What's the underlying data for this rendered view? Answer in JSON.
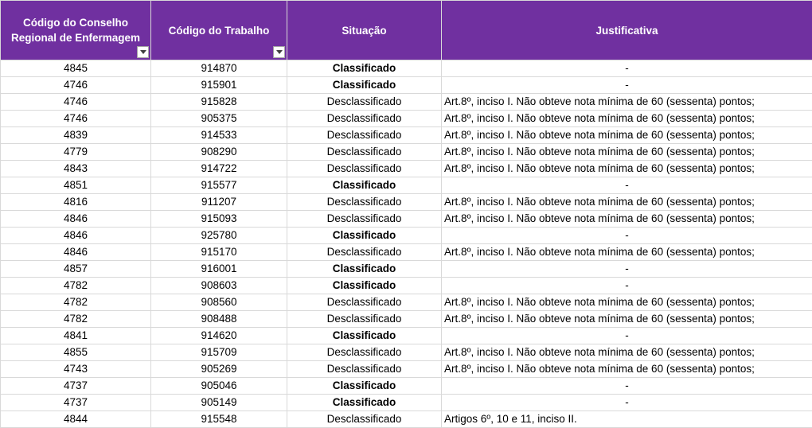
{
  "headers": {
    "conselho": "Código do Conselho Regional de Enfermagem",
    "trabalho": "Código do Trabalho",
    "situacao": "Situação",
    "justificativa": "Justificativa"
  },
  "rows": [
    {
      "conselho": "4845",
      "trabalho": "914870",
      "situacao": "Classificado",
      "justificativa": "-"
    },
    {
      "conselho": "4746",
      "trabalho": "915901",
      "situacao": "Classificado",
      "justificativa": "-"
    },
    {
      "conselho": "4746",
      "trabalho": "915828",
      "situacao": "Desclassificado",
      "justificativa": "Art.8º, inciso I. Não obteve nota mínima de 60 (sessenta) pontos;"
    },
    {
      "conselho": "4746",
      "trabalho": "905375",
      "situacao": "Desclassificado",
      "justificativa": "Art.8º, inciso I. Não obteve nota mínima de 60 (sessenta) pontos;"
    },
    {
      "conselho": "4839",
      "trabalho": "914533",
      "situacao": "Desclassificado",
      "justificativa": "Art.8º, inciso I. Não obteve nota mínima de 60 (sessenta) pontos;"
    },
    {
      "conselho": "4779",
      "trabalho": "908290",
      "situacao": "Desclassificado",
      "justificativa": "Art.8º, inciso I. Não obteve nota mínima de 60 (sessenta) pontos;"
    },
    {
      "conselho": "4843",
      "trabalho": "914722",
      "situacao": "Desclassificado",
      "justificativa": "Art.8º, inciso I. Não obteve nota mínima de 60 (sessenta) pontos;"
    },
    {
      "conselho": "4851",
      "trabalho": "915577",
      "situacao": "Classificado",
      "justificativa": "-"
    },
    {
      "conselho": "4816",
      "trabalho": "911207",
      "situacao": "Desclassificado",
      "justificativa": "Art.8º, inciso I. Não obteve nota mínima de 60 (sessenta) pontos;"
    },
    {
      "conselho": "4846",
      "trabalho": "915093",
      "situacao": "Desclassificado",
      "justificativa": "Art.8º, inciso I. Não obteve nota mínima de 60 (sessenta) pontos;"
    },
    {
      "conselho": "4846",
      "trabalho": "925780",
      "situacao": "Classificado",
      "justificativa": "-"
    },
    {
      "conselho": "4846",
      "trabalho": "915170",
      "situacao": "Desclassificado",
      "justificativa": "Art.8º, inciso I. Não obteve nota mínima de 60 (sessenta) pontos;"
    },
    {
      "conselho": "4857",
      "trabalho": "916001",
      "situacao": "Classificado",
      "justificativa": "-"
    },
    {
      "conselho": "4782",
      "trabalho": "908603",
      "situacao": "Classificado",
      "justificativa": "-"
    },
    {
      "conselho": "4782",
      "trabalho": "908560",
      "situacao": "Desclassificado",
      "justificativa": "Art.8º, inciso I. Não obteve nota mínima de 60 (sessenta) pontos;"
    },
    {
      "conselho": "4782",
      "trabalho": "908488",
      "situacao": "Desclassificado",
      "justificativa": "Art.8º, inciso I. Não obteve nota mínima de 60 (sessenta) pontos;"
    },
    {
      "conselho": "4841",
      "trabalho": "914620",
      "situacao": "Classificado",
      "justificativa": "-"
    },
    {
      "conselho": "4855",
      "trabalho": "915709",
      "situacao": "Desclassificado",
      "justificativa": "Art.8º, inciso I. Não obteve nota mínima de 60 (sessenta) pontos;"
    },
    {
      "conselho": "4743",
      "trabalho": "905269",
      "situacao": "Desclassificado",
      "justificativa": "Art.8º, inciso I. Não obteve nota mínima de 60 (sessenta) pontos;"
    },
    {
      "conselho": "4737",
      "trabalho": "905046",
      "situacao": "Classificado",
      "justificativa": "-"
    },
    {
      "conselho": "4737",
      "trabalho": "905149",
      "situacao": "Classificado",
      "justificativa": "-"
    },
    {
      "conselho": "4844",
      "trabalho": "915548",
      "situacao": "Desclassificado",
      "justificativa": "Artigos 6º, 10 e 11, inciso II."
    }
  ]
}
